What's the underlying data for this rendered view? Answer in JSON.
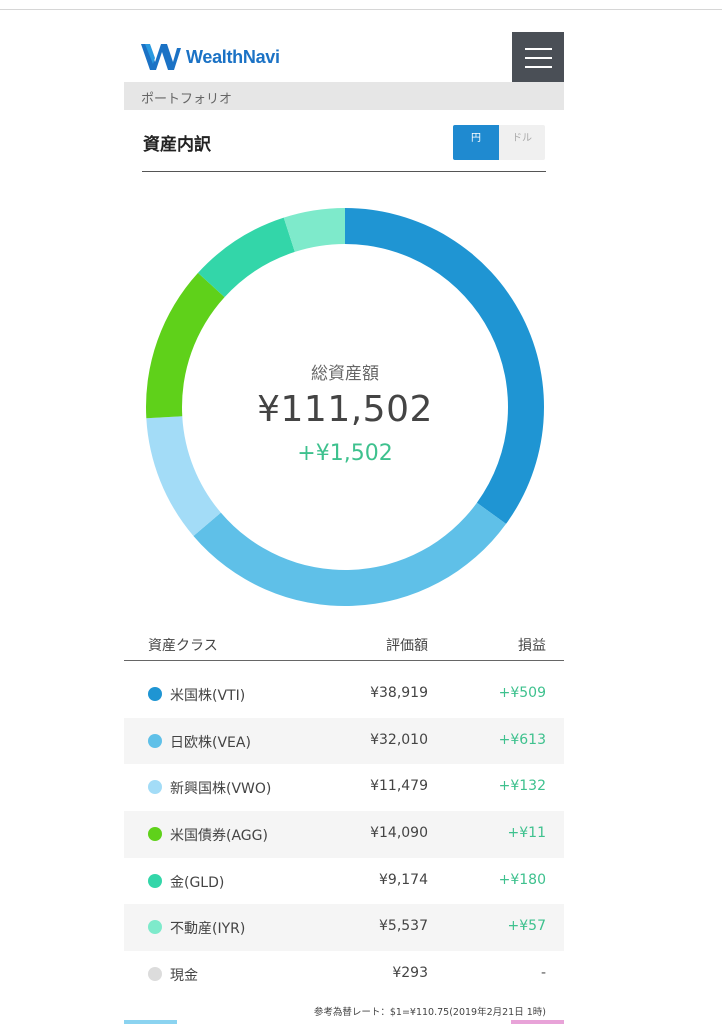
{
  "header": {
    "logo_text": "WealthNavi",
    "menu_icon": "hamburger-menu-icon"
  },
  "breadcrumb": "ポートフォリオ",
  "section": {
    "title": "資産内訳",
    "toggle": {
      "yen_label": "円",
      "dollar_label": "ドル",
      "selected": "yen"
    }
  },
  "summary": {
    "label": "総資産額",
    "total": "¥111,502",
    "gain": "+¥1,502"
  },
  "table": {
    "headers": {
      "asset_class": "資産クラス",
      "value": "評価額",
      "gain": "損益"
    },
    "rows": [
      {
        "name": "米国株(VTI)",
        "value": "¥38,919",
        "gain": "+¥509",
        "color": "#1f95d3"
      },
      {
        "name": "日欧株(VEA)",
        "value": "¥32,010",
        "gain": "+¥613",
        "color": "#5fc0e8"
      },
      {
        "name": "新興国株(VWO)",
        "value": "¥11,479",
        "gain": "+¥132",
        "color": "#a3dcf7"
      },
      {
        "name": "米国債券(AGG)",
        "value": "¥14,090",
        "gain": "+¥11",
        "color": "#5fd11a"
      },
      {
        "name": "金(GLD)",
        "value": "¥9,174",
        "gain": "+¥180",
        "color": "#33d6a9"
      },
      {
        "name": "不動産(IYR)",
        "value": "¥5,537",
        "gain": "+¥57",
        "color": "#7eeacb"
      },
      {
        "name": "現金",
        "value": "¥293",
        "gain": "-",
        "color": "#dcdcdc"
      }
    ]
  },
  "footnote": "参考為替レート：$1=¥110.75(2019年2月21日 1時)",
  "colors": {
    "brand": "#1b72c5",
    "accent": "#1f8ad0",
    "positive": "#3ec18e"
  }
}
